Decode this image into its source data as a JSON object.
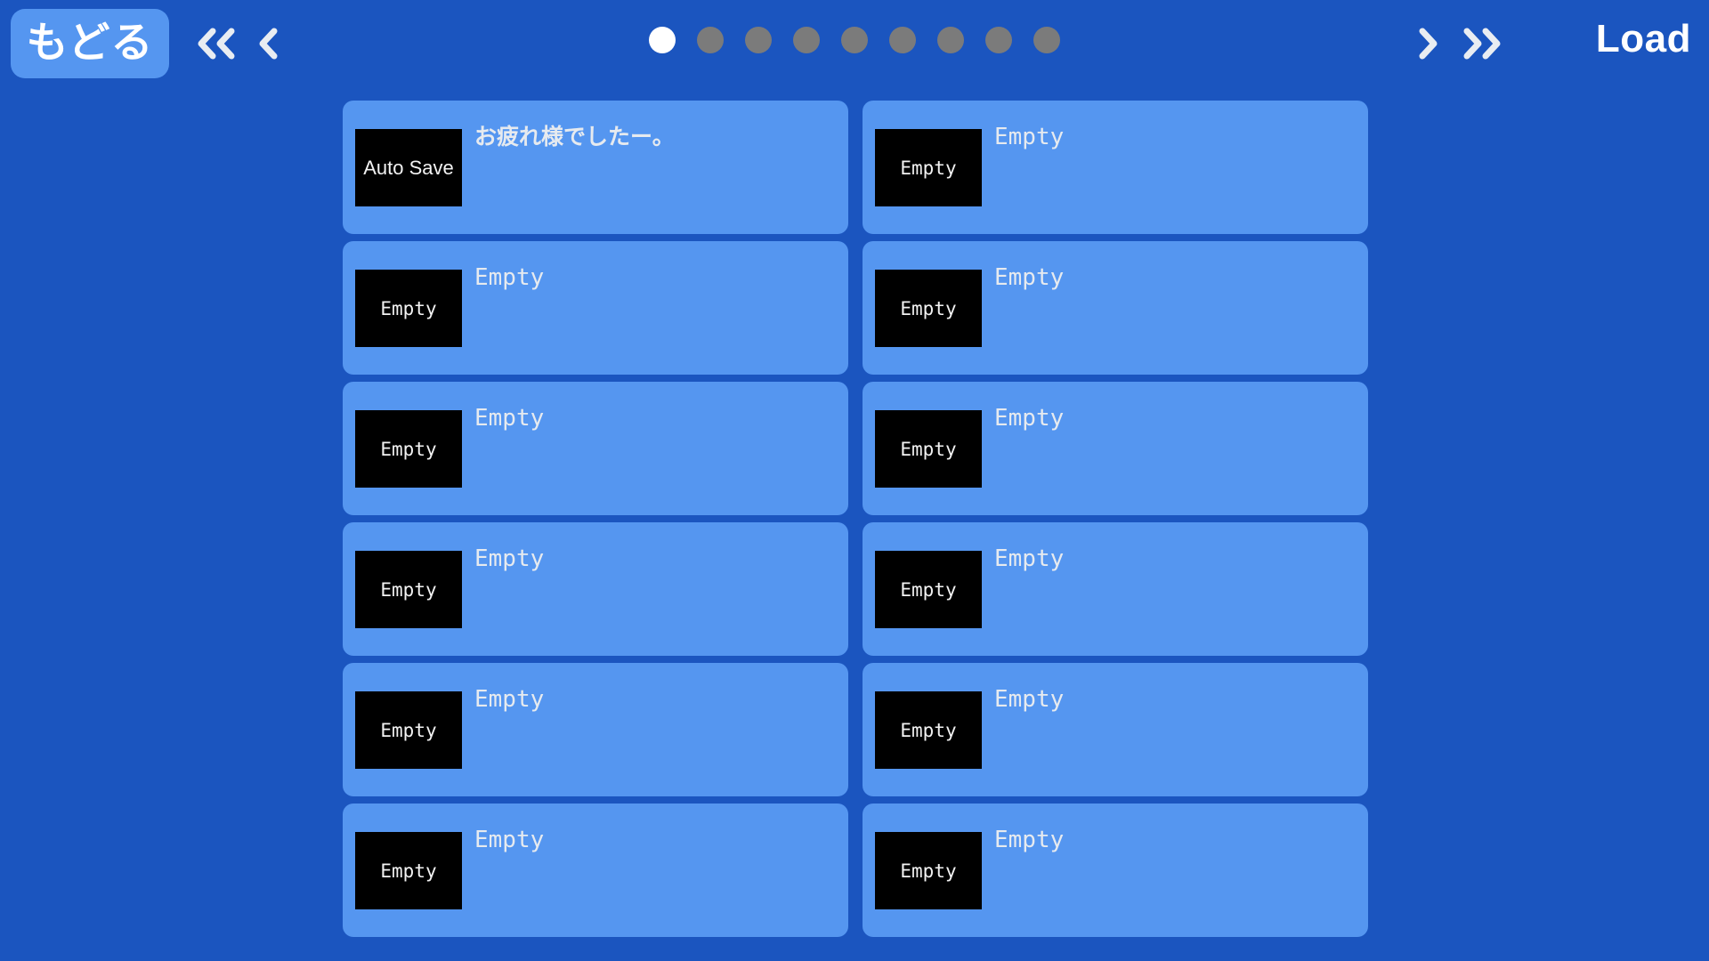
{
  "screen": {
    "title": "Load",
    "background_color": "#1b55bf",
    "card_color": "#5596f0"
  },
  "topbar": {
    "back_label": "もどる",
    "nav_left": [
      {
        "name": "first-page",
        "glyph": "double-chevron-left"
      },
      {
        "name": "prev-page",
        "glyph": "chevron-left"
      }
    ],
    "nav_right": [
      {
        "name": "next-page",
        "glyph": "chevron-right"
      },
      {
        "name": "last-page",
        "glyph": "double-chevron-right"
      }
    ],
    "title_label": "Load"
  },
  "pagination": {
    "total": 9,
    "active_index": 0,
    "active_color": "#ffffff",
    "inactive_color": "#7b7b7b"
  },
  "slots": [
    {
      "thumb": "Auto Save",
      "label": "お疲れ様でしたー。",
      "mono": false,
      "empty": false
    },
    {
      "thumb": "Empty",
      "label": "Empty",
      "mono": true,
      "empty": true
    },
    {
      "thumb": "Empty",
      "label": "Empty",
      "mono": true,
      "empty": true
    },
    {
      "thumb": "Empty",
      "label": "Empty",
      "mono": true,
      "empty": true
    },
    {
      "thumb": "Empty",
      "label": "Empty",
      "mono": true,
      "empty": true
    },
    {
      "thumb": "Empty",
      "label": "Empty",
      "mono": true,
      "empty": true
    },
    {
      "thumb": "Empty",
      "label": "Empty",
      "mono": true,
      "empty": true
    },
    {
      "thumb": "Empty",
      "label": "Empty",
      "mono": true,
      "empty": true
    },
    {
      "thumb": "Empty",
      "label": "Empty",
      "mono": true,
      "empty": true
    },
    {
      "thumb": "Empty",
      "label": "Empty",
      "mono": true,
      "empty": true
    },
    {
      "thumb": "Empty",
      "label": "Empty",
      "mono": true,
      "empty": true
    },
    {
      "thumb": "Empty",
      "label": "Empty",
      "mono": true,
      "empty": true
    }
  ]
}
